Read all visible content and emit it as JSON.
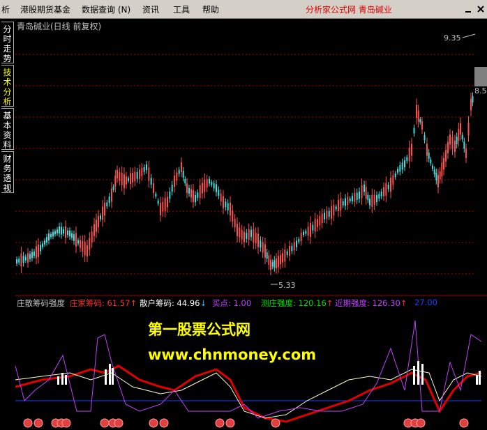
{
  "menubar": {
    "items": [
      "析",
      "港股期货基金",
      "数据查询 (N)",
      "资讯",
      "工具",
      "帮助"
    ],
    "accent_text": "分析家公式网 青岛碱业",
    "accent_color": "#e00000",
    "icons": [
      "minimize-icon",
      "close-icon"
    ]
  },
  "sidebar": {
    "tabs": [
      {
        "label": "分时走势",
        "active": false
      },
      {
        "label": "技术分析",
        "active": true
      },
      {
        "label": "基本资料",
        "active": false
      },
      {
        "label": "财务透视",
        "active": false
      }
    ]
  },
  "main_chart": {
    "title": "青岛碱业(日线 前复权)",
    "high_label": "9.35",
    "low_label": "5.33",
    "right_axis_label": "8.5"
  },
  "indicator": {
    "name": "庄散筹码强度",
    "items": [
      {
        "label": "庄家筹码: 61.57",
        "color": "#ff3030",
        "arrow": "↑",
        "arrow_color": "#ff3030"
      },
      {
        "label": "散户筹码: 44.96",
        "color": "#ffffff",
        "arrow": "↓",
        "arrow_color": "#00c0ff"
      },
      {
        "label": "买点: 1.00",
        "color": "#c040ff",
        "arrow": "",
        "arrow_color": ""
      },
      {
        "label": "测庄强度: 120.16",
        "color": "#00e000",
        "arrow": "↑",
        "arrow_color": "#ff3030"
      },
      {
        "label": "近期强度: 126.30",
        "color": "#c040ff",
        "arrow": "↑",
        "arrow_color": "#ff3030"
      },
      {
        "label": "27.00",
        "color": "#2040ff",
        "arrow": "",
        "arrow_color": ""
      }
    ]
  },
  "watermark": {
    "line1": "第一股票公式网",
    "line2": "www.chnmoney.com",
    "color": "#ffff00"
  },
  "colors": {
    "up_candle": "#ff5050",
    "down_candle": "#40e0e0",
    "grid": "#a00000",
    "background": "#000000"
  }
}
